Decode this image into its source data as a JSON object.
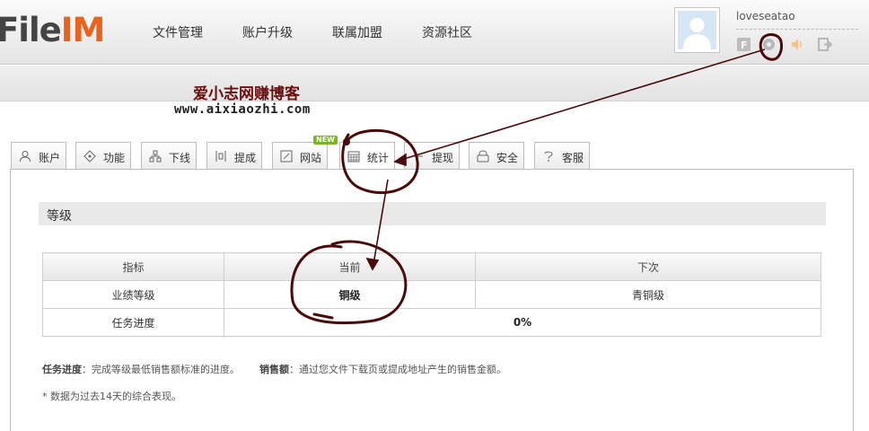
{
  "header": {
    "logo_file": "File",
    "logo_im": "IM",
    "nav": [
      "文件管理",
      "账户升级",
      "联属加盟",
      "资源社区"
    ]
  },
  "user": {
    "name": "loveseatao",
    "icons": [
      "f-icon",
      "gear-icon",
      "sound-icon",
      "logout-icon"
    ]
  },
  "watermark": {
    "title": "爱小志网赚博客",
    "url": "www.aixiaozhi.com"
  },
  "tabs": [
    {
      "label": "账户",
      "icon": "user-icon"
    },
    {
      "label": "功能",
      "icon": "diamond-icon"
    },
    {
      "label": "下线",
      "icon": "tree-icon"
    },
    {
      "label": "提成",
      "icon": "commission-icon"
    },
    {
      "label": "网站",
      "icon": "website-icon",
      "badge": "NEW"
    },
    {
      "label": "统计",
      "icon": "calendar-icon",
      "active": true
    },
    {
      "label": "提现",
      "icon": "withdraw-icon"
    },
    {
      "label": "安全",
      "icon": "lock-icon"
    },
    {
      "label": "客服",
      "icon": "question-icon"
    }
  ],
  "section": {
    "title": "等级"
  },
  "table": {
    "headers": [
      "指标",
      "当前",
      "下次"
    ],
    "rows": [
      {
        "label": "业绩等级",
        "current": "铜级",
        "next": "青铜级"
      },
      {
        "label": "任务进度",
        "value": "0%"
      }
    ]
  },
  "notes": {
    "task_label": "任务进度",
    "task_text": "：完成等级最低销售额标准的进度。",
    "sales_label": "销售额",
    "sales_text": "：通过您文件下载页或提成地址产生的销售金额。",
    "footnote": "* 数据为过去14天的综合表现。"
  },
  "colors": {
    "brand_orange": "#e8641e",
    "annotation": "#4a0a0a",
    "badge_green": "#79b624"
  }
}
